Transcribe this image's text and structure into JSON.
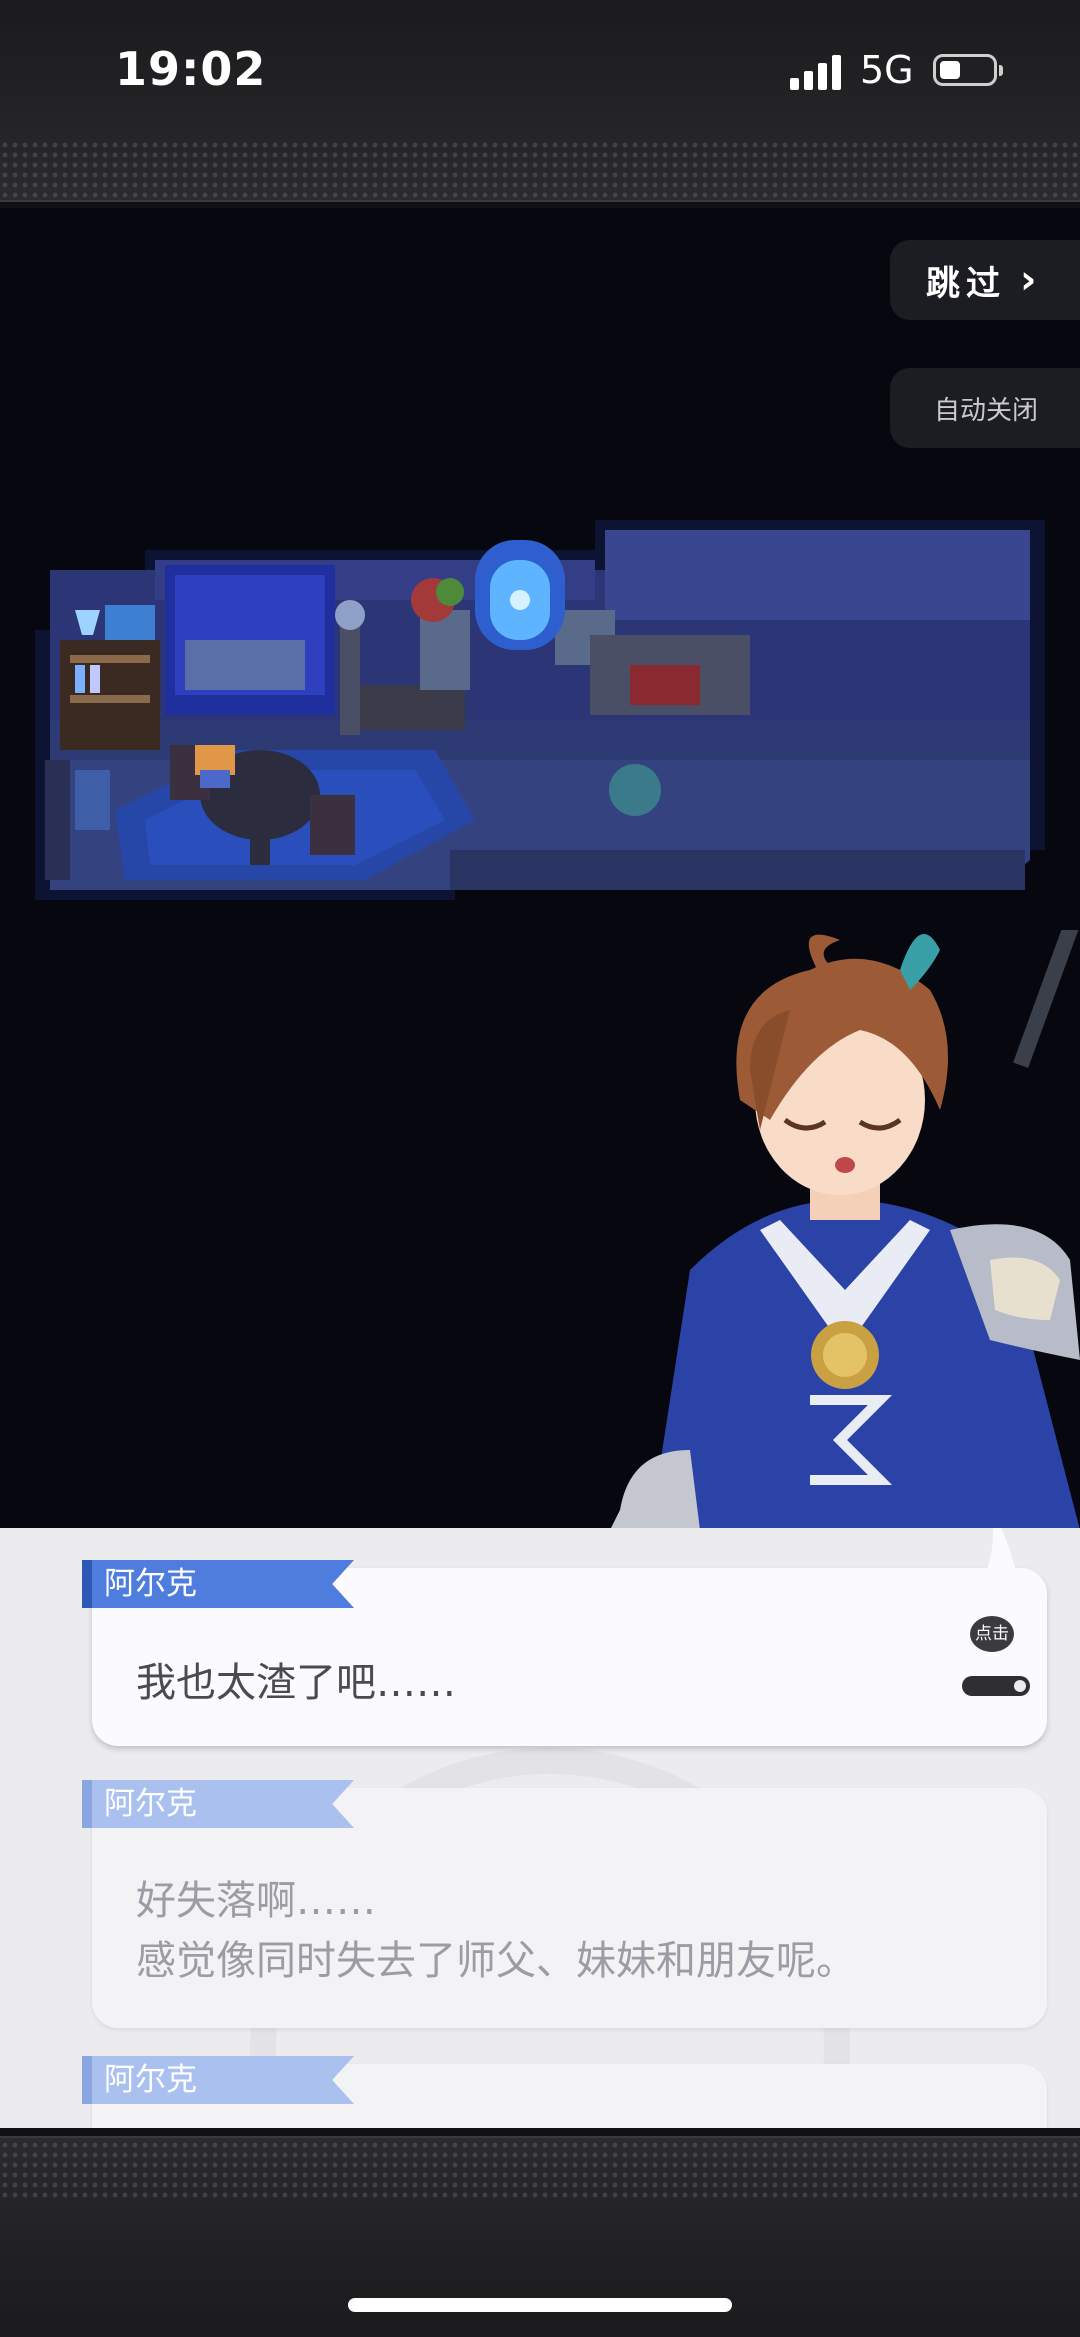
{
  "status_bar": {
    "time": "19:02",
    "network": "5G"
  },
  "controls": {
    "skip_label": "跳过",
    "auto_label": "自动关闭"
  },
  "dialogue": {
    "current": {
      "speaker": "阿尔克",
      "text": "我也太渣了吧……",
      "tap_hint": "点击"
    },
    "history": [
      {
        "speaker": "阿尔克",
        "lines": [
          "好失落啊……",
          "感觉像同时失去了师父、妹妹和朋友呢。"
        ]
      },
      {
        "speaker": "阿尔克"
      }
    ]
  },
  "colors": {
    "name_tag": "#4f7ddd",
    "background": "#07080f",
    "panel": "#ececef"
  }
}
